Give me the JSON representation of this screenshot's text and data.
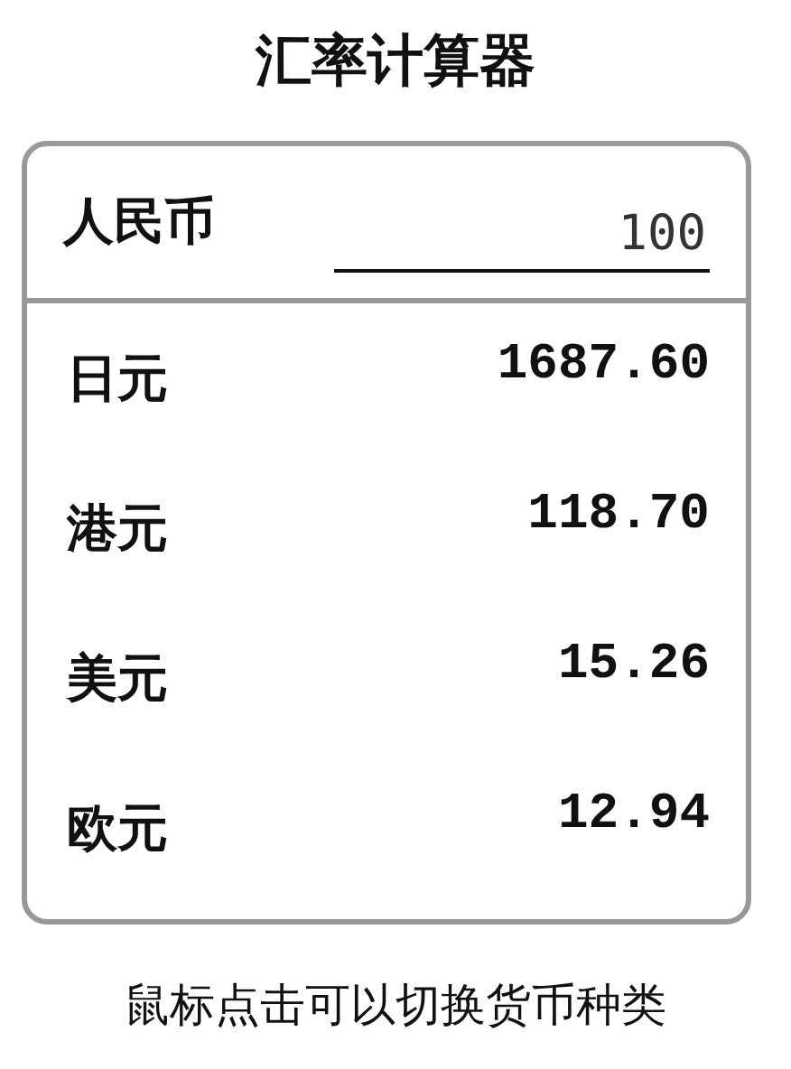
{
  "title": "汇率计算器",
  "source": {
    "currency": "人民币",
    "value": "100"
  },
  "results": [
    {
      "currency": "日元",
      "amount": "1687.60"
    },
    {
      "currency": "港元",
      "amount": "118.70"
    },
    {
      "currency": "美元",
      "amount": "15.26"
    },
    {
      "currency": "欧元",
      "amount": "12.94"
    }
  ],
  "hint": "鼠标点击可以切换货币种类"
}
